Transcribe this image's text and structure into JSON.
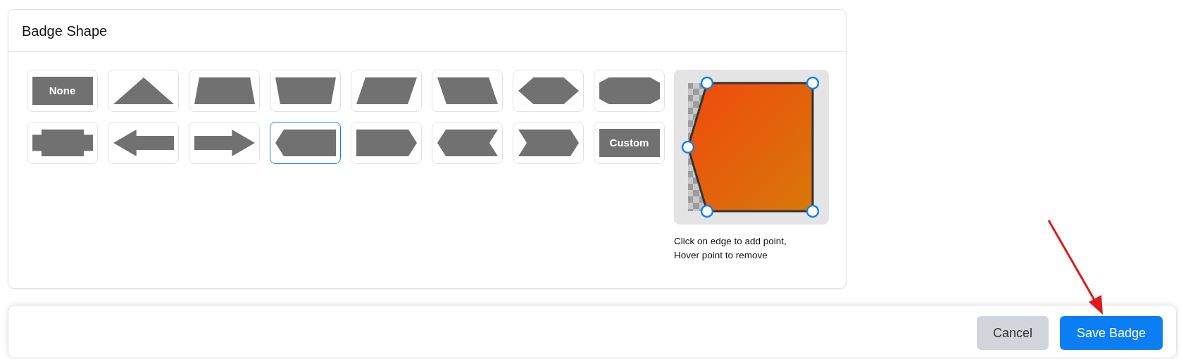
{
  "panel": {
    "title": "Badge Shape"
  },
  "shapes": [
    {
      "kind": "labelled",
      "label": "None",
      "selected": false
    },
    {
      "kind": "triangle",
      "selected": false
    },
    {
      "kind": "trapezoid",
      "selected": false
    },
    {
      "kind": "inverted-trapezoid",
      "selected": false
    },
    {
      "kind": "slant-right",
      "selected": false
    },
    {
      "kind": "slant-left",
      "selected": false
    },
    {
      "kind": "hexagon",
      "selected": false
    },
    {
      "kind": "octagon",
      "selected": false
    },
    {
      "kind": "notched-rectangle",
      "selected": false
    },
    {
      "kind": "arrow-left",
      "selected": false
    },
    {
      "kind": "arrow-right",
      "selected": false
    },
    {
      "kind": "point-left",
      "selected": true
    },
    {
      "kind": "point-right",
      "selected": false
    },
    {
      "kind": "tag-left",
      "selected": false
    },
    {
      "kind": "chevron-right",
      "selected": false
    },
    {
      "kind": "labelled",
      "label": "Custom",
      "selected": false
    }
  ],
  "editor": {
    "hint": "Click on edge to add point, Hover point to remove"
  },
  "footer": {
    "buttons": [
      {
        "kind": "secondary",
        "label": "Cancel"
      },
      {
        "kind": "primary",
        "label": "Save Badge"
      }
    ]
  }
}
